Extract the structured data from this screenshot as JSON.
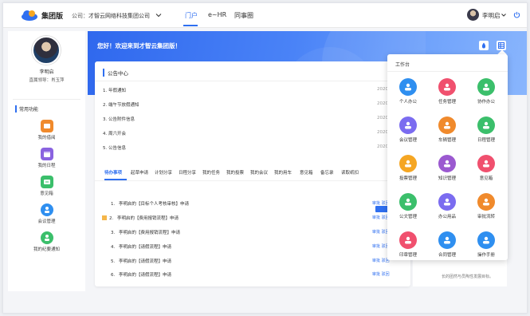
{
  "header": {
    "brand": "集团版",
    "company_label": "公司：",
    "company_value": "才智云网络科技集团公司",
    "nav": [
      "门户",
      "e~HR",
      "同事圈"
    ],
    "user_name": "李明启"
  },
  "sidebar": {
    "name": "李明启",
    "leader": "直属领导：肖玉萍",
    "section_title": "常用功能",
    "items": [
      {
        "label": "我的借阅",
        "icon": "folder-icon",
        "color": "#f08a2c"
      },
      {
        "label": "我的日程",
        "icon": "calendar-icon",
        "color": "#8a63e0"
      },
      {
        "label": "意见箱",
        "icon": "mailbox-icon",
        "color": "#3bbf6b"
      },
      {
        "label": "会议管理",
        "icon": "meeting-icon",
        "color": "#2f8ff0"
      },
      {
        "label": "我的纪要通知",
        "icon": "notice-icon",
        "color": "#3bbf6b"
      }
    ]
  },
  "banner": {
    "greeting": "您好！欢迎来到才智云集团版！"
  },
  "notice": {
    "title": "公告中心",
    "items": [
      {
        "num": "1.",
        "text": "年假通知",
        "date": "2020"
      },
      {
        "num": "2.",
        "text": "端午节放假通知",
        "date": "2020"
      },
      {
        "num": "3.",
        "text": "公告附件信息",
        "date": "2020"
      },
      {
        "num": "4.",
        "text": "周六开会",
        "date": "2020"
      },
      {
        "num": "5.",
        "text": "公告信息",
        "date": "2020"
      }
    ]
  },
  "tabs": [
    "待办事项",
    "起草申请",
    "计划分享",
    "日程分享",
    "我的任务",
    "我的投票",
    "我的会议",
    "我的用车",
    "意见箱",
    "备忘录",
    "读取纸扣"
  ],
  "todos": [
    {
      "num": "1.",
      "text": "李明启的【目标个人考核审核】申请",
      "action": "审批 驳回",
      "flag": false
    },
    {
      "num": "2.",
      "text": "李明启的【费用报销流程】申请",
      "action": "审批 驳回",
      "flag": true
    },
    {
      "num": "3.",
      "text": "李明启的【费用报销流程】申请",
      "action": "审批 驳回",
      "flag": false
    },
    {
      "num": "4.",
      "text": "李明启的【请假流程】申请",
      "action": "审批 驳回",
      "flag": false
    },
    {
      "num": "5.",
      "text": "李明启的【请假流程】申请",
      "action": "审批 驳回",
      "flag": false
    },
    {
      "num": "6.",
      "text": "李明启的【请假流程】申请",
      "action": "审批 驳回",
      "flag": false
    }
  ],
  "promo_text": "长的团然与员陶性发展目标。",
  "workbench": {
    "title": "工作台",
    "items": [
      {
        "label": "个人办公",
        "icon": "person-icon",
        "color": "#2f8ff0"
      },
      {
        "label": "任务管理",
        "icon": "task-icon",
        "color": "#f0506e"
      },
      {
        "label": "协作办公",
        "icon": "collab-icon",
        "color": "#3bbf6b"
      },
      {
        "label": "会议管理",
        "icon": "meeting-icon",
        "color": "#7b6cf0"
      },
      {
        "label": "车辆管理",
        "icon": "car-icon",
        "color": "#f08a2c"
      },
      {
        "label": "日程管理",
        "icon": "schedule-icon",
        "color": "#3bbf6b"
      },
      {
        "label": "投票管理",
        "icon": "vote-icon",
        "color": "#f5a623"
      },
      {
        "label": "知识管理",
        "icon": "knowledge-icon",
        "color": "#9b59d0"
      },
      {
        "label": "意见箱",
        "icon": "opinion-icon",
        "color": "#f0506e"
      },
      {
        "label": "公文管理",
        "icon": "document-icon",
        "color": "#3bbf6b"
      },
      {
        "label": "办公用品",
        "icon": "supplies-icon",
        "color": "#7b6cf0"
      },
      {
        "label": "审批流转",
        "icon": "approval-icon",
        "color": "#f08a2c"
      },
      {
        "label": "印章管理",
        "icon": "seal-icon",
        "color": "#f0506e"
      },
      {
        "label": "合同管理",
        "icon": "contract-icon",
        "color": "#2f8ff0"
      },
      {
        "label": "操作手册",
        "icon": "manual-icon",
        "color": "#2f8ff0"
      }
    ]
  }
}
